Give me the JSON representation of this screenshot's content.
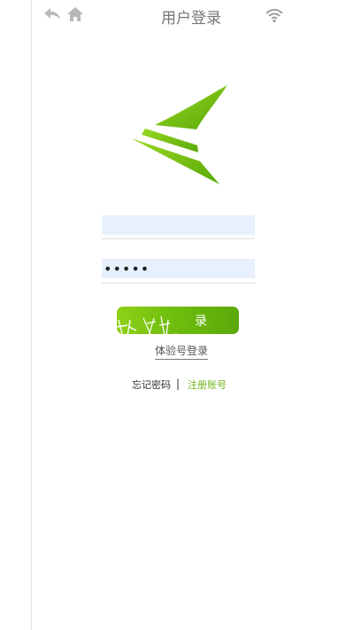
{
  "header": {
    "title": "用户登录",
    "icons": [
      "back-icon",
      "home-icon",
      "wifi-icon"
    ]
  },
  "form": {
    "username_value": "",
    "password_value": "•••••"
  },
  "actions": {
    "login_label": "录",
    "login_overlay_text": "妙 登 秋",
    "trial_login": "体验号登录",
    "forgot_password": "忘记密码",
    "separator": "|",
    "register": "注册账号"
  },
  "colors": {
    "accent_green": "#6db41a",
    "icon_gray": "#b8b8b8",
    "field_bg": "#e8f0fd"
  }
}
